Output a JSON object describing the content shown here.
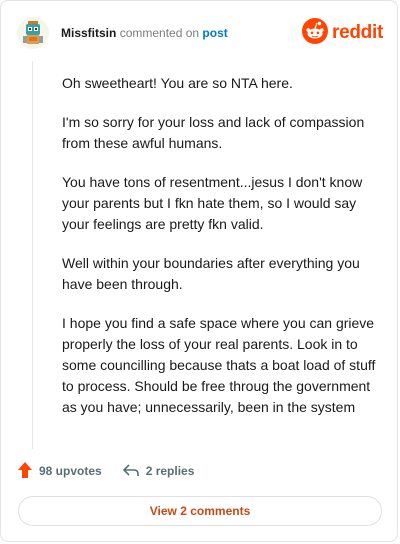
{
  "comment": {
    "username": "Missfitsin",
    "action_text": "commented on",
    "target": "post",
    "paragraphs": [
      "Oh sweetheart! You are so NTA here.",
      "I'm so sorry for your loss and lack of compassion from these awful humans.",
      "You have tons of resentment...jesus I don't know your parents but I fkn hate them, so I would say your feelings are pretty fkn valid.",
      "Well within your boundaries after everything you have been through.",
      "I hope you find a safe space where you can grieve properly the loss of your real parents. Look in to some councilling because thats a boat load of stuff to process. Should be free throug the government as you have; unnecessarily, been in the system"
    ]
  },
  "brand": {
    "name": "reddit",
    "color": "#ff4500"
  },
  "footer": {
    "upvotes": "98 upvotes",
    "replies": "2 replies",
    "view_comments": "View 2 comments"
  },
  "icons": {
    "avatar": "avatar-icon",
    "logo": "reddit-logo-icon",
    "upvote": "upvote-arrow-icon",
    "reply": "reply-arrow-icon"
  }
}
